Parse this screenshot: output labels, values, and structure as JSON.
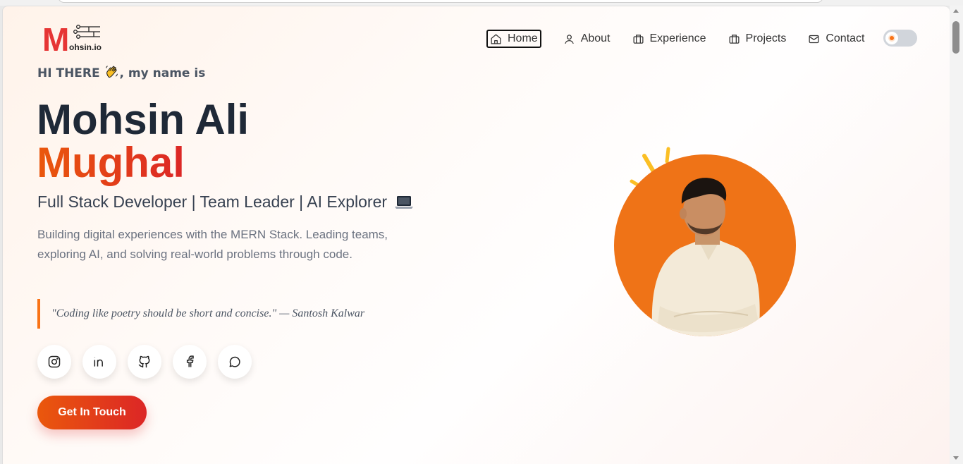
{
  "logo": {
    "letter": "M",
    "text": "ohsin.io"
  },
  "nav": {
    "items": [
      {
        "label": "Home",
        "icon": "home-icon"
      },
      {
        "label": "About",
        "icon": "user-icon"
      },
      {
        "label": "Experience",
        "icon": "briefcase-icon"
      },
      {
        "label": "Projects",
        "icon": "briefcase-icon"
      },
      {
        "label": "Contact",
        "icon": "mail-icon"
      }
    ]
  },
  "hero": {
    "greeting_prefix": "HI THERE",
    "greeting_suffix": ", my name is",
    "first_name": "Mohsin Ali",
    "last_name": "Mughal",
    "subtitle": "Full Stack Developer | Team Leader | AI Explorer",
    "description": "Building digital experiences with the MERN Stack. Leading teams, exploring AI, and solving real-world problems through code.",
    "quote": "\"Coding like poetry should be short and concise.\" — Santosh Kalwar",
    "cta_label": "Get In Touch"
  },
  "socials": [
    {
      "icon": "instagram-icon"
    },
    {
      "icon": "linkedin-icon"
    },
    {
      "icon": "github-icon"
    },
    {
      "icon": "facebook-icon"
    },
    {
      "icon": "whatsapp-icon"
    }
  ],
  "colors": {
    "accent": "#ea580c",
    "accent_end": "#dc2626",
    "portrait_bg": "#ef7317",
    "heading": "#1f2937"
  }
}
